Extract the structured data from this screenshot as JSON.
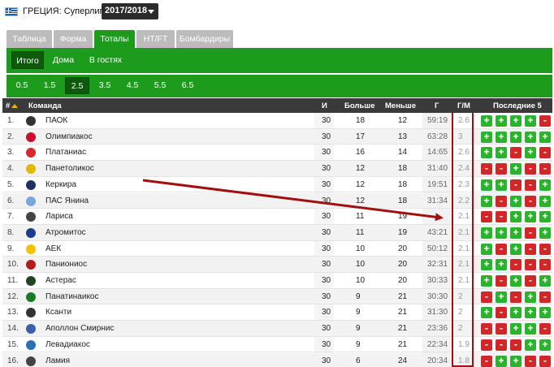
{
  "header": {
    "league": "ГРЕЦИЯ: Суперлига",
    "season": "2017/2018"
  },
  "tabs_main": [
    "Таблица",
    "Форма",
    "Тоталы",
    "HT/FT",
    "Бомбардиры"
  ],
  "tabs_main_active": 2,
  "tabs_venue": [
    "Итого",
    "Дома",
    "В гостях"
  ],
  "tabs_venue_active": 0,
  "tabs_total": [
    "0.5",
    "1.5",
    "2.5",
    "3.5",
    "4.5",
    "5.5",
    "6.5"
  ],
  "tabs_total_active": 2,
  "columns": {
    "pos": "#",
    "team": "Команда",
    "games": "И",
    "over": "Больше",
    "under": "Меньше",
    "goals": "Г",
    "gpm": "Г/М",
    "last5": "Последние 5"
  },
  "colors": {
    "accent": "#1c9b1c",
    "win": "#2db22d",
    "loss": "#d02828",
    "highlight": "#a01010"
  },
  "rows": [
    {
      "pos": "1.",
      "team": "ПАОК",
      "games": "30",
      "over": "18",
      "under": "12",
      "goals": "59:19",
      "gpm": "2.6",
      "last5": [
        "+",
        "+",
        "+",
        "+",
        "-"
      ],
      "logo": "#333333"
    },
    {
      "pos": "2.",
      "team": "Олимпиакос",
      "games": "30",
      "over": "17",
      "under": "13",
      "goals": "63:28",
      "gpm": "3",
      "last5": [
        "+",
        "+",
        "+",
        "+",
        "+"
      ],
      "logo": "#c8102e"
    },
    {
      "pos": "3.",
      "team": "Платаниас",
      "games": "30",
      "over": "16",
      "under": "14",
      "goals": "14:65",
      "gpm": "2.6",
      "last5": [
        "+",
        "+",
        "-",
        "+",
        "-"
      ],
      "logo": "#d22b2b"
    },
    {
      "pos": "4.",
      "team": "Панетоликос",
      "games": "30",
      "over": "12",
      "under": "18",
      "goals": "31:40",
      "gpm": "2.4",
      "last5": [
        "-",
        "-",
        "+",
        "-",
        "-"
      ],
      "logo": "#e0b800"
    },
    {
      "pos": "5.",
      "team": "Керкира",
      "games": "30",
      "over": "12",
      "under": "18",
      "goals": "19:51",
      "gpm": "2.3",
      "last5": [
        "+",
        "+",
        "-",
        "-",
        "+"
      ],
      "logo": "#203060"
    },
    {
      "pos": "6.",
      "team": "ПАС Янина",
      "games": "30",
      "over": "12",
      "under": "18",
      "goals": "31:34",
      "gpm": "2.2",
      "last5": [
        "+",
        "-",
        "+",
        "-",
        "+"
      ],
      "logo": "#7aa7d8"
    },
    {
      "pos": "7.",
      "team": "Лариса",
      "games": "30",
      "over": "11",
      "under": "19",
      "goals": "",
      "gpm": "2.1",
      "last5": [
        "-",
        "-",
        "+",
        "+",
        "+"
      ],
      "logo": "#444444"
    },
    {
      "pos": "8.",
      "team": "Атромитос",
      "games": "30",
      "over": "11",
      "under": "19",
      "goals": "43:21",
      "gpm": "2.1",
      "last5": [
        "+",
        "+",
        "+",
        "-",
        "+"
      ],
      "logo": "#1d3b8a"
    },
    {
      "pos": "9.",
      "team": "АЕК",
      "games": "30",
      "over": "10",
      "under": "20",
      "goals": "50:12",
      "gpm": "2.1",
      "last5": [
        "+",
        "-",
        "+",
        "-",
        "-"
      ],
      "logo": "#f2c200"
    },
    {
      "pos": "10.",
      "team": "Паниониос",
      "games": "30",
      "over": "10",
      "under": "20",
      "goals": "32:31",
      "gpm": "2.1",
      "last5": [
        "+",
        "+",
        "-",
        "-",
        "-"
      ],
      "logo": "#b01b1b"
    },
    {
      "pos": "11.",
      "team": "Астерас",
      "games": "30",
      "over": "10",
      "under": "20",
      "goals": "30:33",
      "gpm": "2.1",
      "last5": [
        "+",
        "-",
        "+",
        "-",
        "+"
      ],
      "logo": "#224422"
    },
    {
      "pos": "12.",
      "team": "Панатинаикос",
      "games": "30",
      "over": "9",
      "under": "21",
      "goals": "30:30",
      "gpm": "2",
      "last5": [
        "-",
        "+",
        "-",
        "+",
        "-"
      ],
      "logo": "#1a7a2a"
    },
    {
      "pos": "13.",
      "team": "Ксанти",
      "games": "30",
      "over": "9",
      "under": "21",
      "goals": "31:30",
      "gpm": "2",
      "last5": [
        "+",
        "-",
        "+",
        "+",
        "+"
      ],
      "logo": "#333333"
    },
    {
      "pos": "14.",
      "team": "Аполлон Смирнис",
      "games": "30",
      "over": "9",
      "under": "21",
      "goals": "23:36",
      "gpm": "2",
      "last5": [
        "-",
        "-",
        "+",
        "+",
        "-"
      ],
      "logo": "#3b5fa8"
    },
    {
      "pos": "15.",
      "team": "Левадиакос",
      "games": "30",
      "over": "9",
      "under": "21",
      "goals": "22:34",
      "gpm": "1.9",
      "last5": [
        "-",
        "-",
        "-",
        "+",
        "+"
      ],
      "logo": "#2b6fb0"
    },
    {
      "pos": "16.",
      "team": "Ламия",
      "games": "30",
      "over": "6",
      "under": "24",
      "goals": "20:34",
      "gpm": "1.8",
      "last5": [
        "-",
        "+",
        "+",
        "-",
        "-"
      ],
      "logo": "#444444"
    }
  ]
}
